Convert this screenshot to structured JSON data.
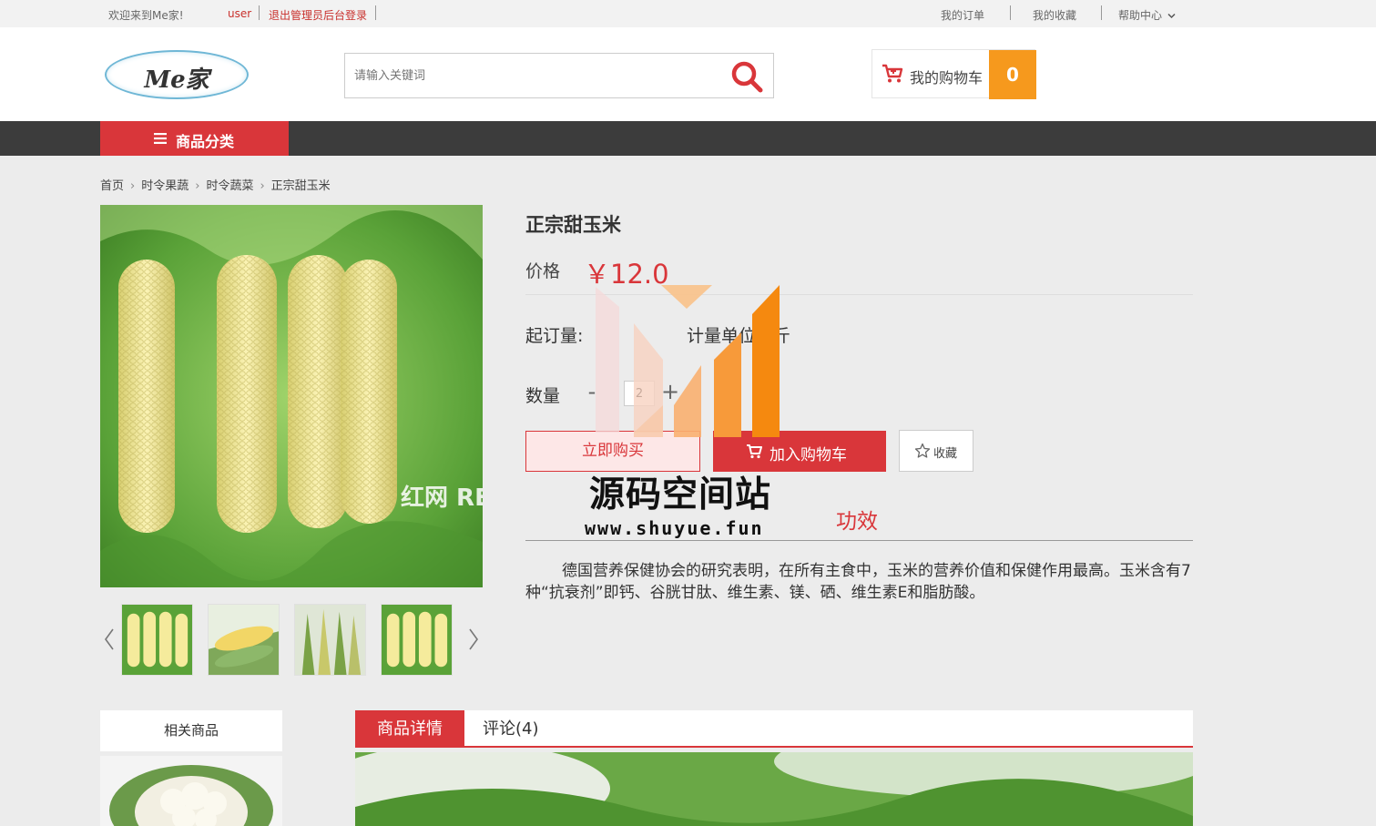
{
  "topbar": {
    "welcome": "欢迎来到Me家!",
    "username": "user",
    "logout": "退出管理员后台登录",
    "my_orders": "我的订单",
    "my_favorites": "我的收藏",
    "help_center": "帮助中心"
  },
  "header": {
    "logo_text": "Me家",
    "search_placeholder": "请输入关键词",
    "cart_label": "我的购物车",
    "cart_count": "0"
  },
  "nav": {
    "category_label": "商品分类"
  },
  "breadcrumb": [
    "首页",
    "时令果蔬",
    "时令蔬菜",
    "正宗甜玉米"
  ],
  "product": {
    "title": "正宗甜玉米",
    "price_label": "价格",
    "price": "￥12.0",
    "moq_label": "起订量:",
    "unit_label": "计量单位：斤",
    "qty_label": "数量",
    "qty_value": "2",
    "qty_minus": "-",
    "qty_plus": "+",
    "buy_now": "立即购买",
    "add_to_cart": "加入购物车",
    "favorite": "收藏",
    "effect_tab": "功效",
    "description": "德国营养保健协会的研究表明，在所有主食中，玉米的营养价值和保健作用最高。玉米含有7种“抗衰剂”即钙、谷胱甘肽、维生素、镁、硒、维生素E和脂肪酸。",
    "image_watermark": "红网 REDNET.CN"
  },
  "watermark": {
    "title": "源码空间站",
    "url": "www.shuyue.fun"
  },
  "related": {
    "title": "相关商品"
  },
  "tabs": {
    "details": "商品详情",
    "comments": "评论(4)"
  },
  "colors": {
    "accent": "#d9363a",
    "cart_badge": "#f6991d",
    "navbar": "#3c3c3c"
  }
}
